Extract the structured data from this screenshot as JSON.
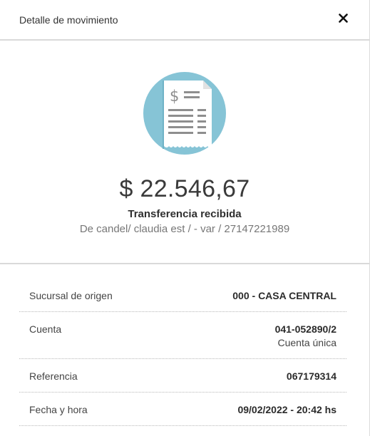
{
  "header": {
    "title": "Detalle de movimiento",
    "close_icon": "close-icon"
  },
  "summary": {
    "icon": "receipt-icon",
    "amount": "$ 22.546,67",
    "type": "Transferencia recibida",
    "description": "De candel/ claudia est / - var / 27147221989"
  },
  "details": {
    "sucursal": {
      "label": "Sucursal de origen",
      "value": "000 - CASA CENTRAL"
    },
    "cuenta": {
      "label": "Cuenta",
      "value": "041-052890/2",
      "subvalue": "Cuenta única"
    },
    "referencia": {
      "label": "Referencia",
      "value": "067179314"
    },
    "fecha": {
      "label": "Fecha y hora",
      "value": "09/02/2022 - 20:42 hs"
    }
  },
  "colors": {
    "icon_circle": "#86c4d6",
    "icon_paper": "#ffffff",
    "icon_lines": "#8e8e8e"
  }
}
